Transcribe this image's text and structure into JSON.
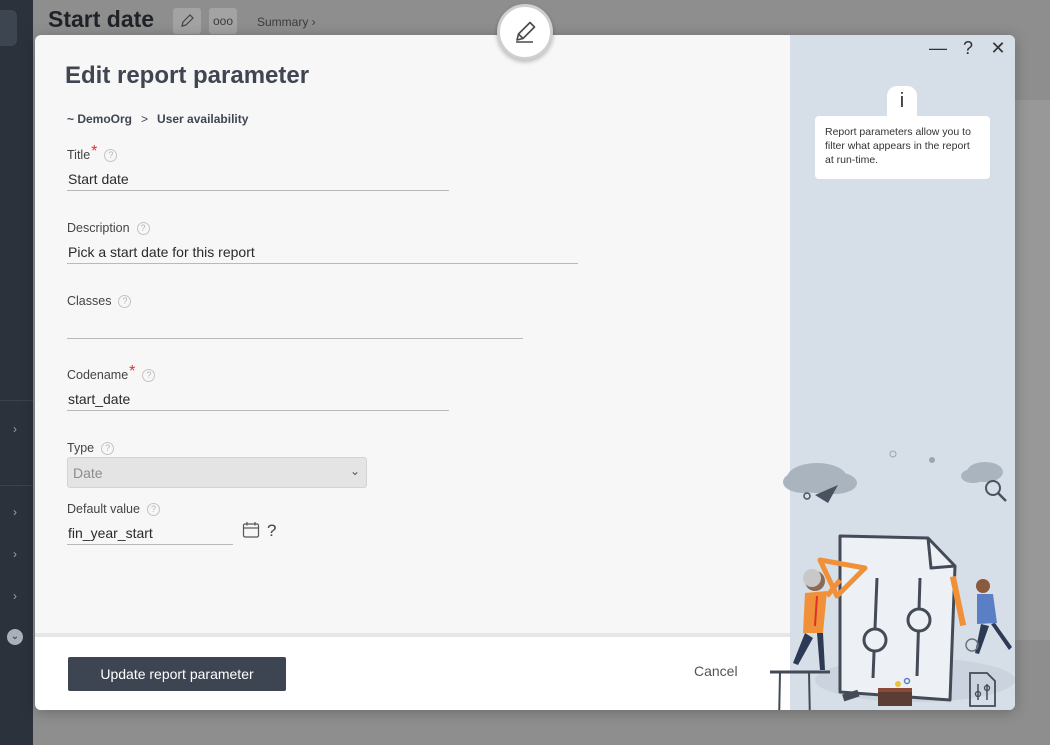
{
  "background": {
    "page_title": "Start date",
    "edit_icon": "pencil-icon",
    "more_icon": "ellipsis-icon",
    "more_label": "ooo",
    "breadcrumb": "Summary ›",
    "rail_chevron": "›",
    "rail_expand": "⌄"
  },
  "modal": {
    "badge_icon": "pencil-icon",
    "title": "Edit report parameter",
    "breadcrumb": {
      "org": "~ DemoOrg",
      "separator": ">",
      "page": "User availability"
    },
    "fields": {
      "title": {
        "label": "Title",
        "required_mark": "*",
        "value": "Start date"
      },
      "description": {
        "label": "Description",
        "value": "Pick a start date for this report"
      },
      "classes": {
        "label": "Classes",
        "value": ""
      },
      "codename": {
        "label": "Codename",
        "required_mark": "*",
        "value": "start_date"
      },
      "type": {
        "label": "Type",
        "selected": "Date",
        "chevron": "⌄"
      },
      "default_value": {
        "label": "Default value",
        "value": "fin_year_start",
        "help_mark": "?"
      }
    },
    "help_mark": "?",
    "primary_button": "Update report parameter",
    "cancel_button": "Cancel"
  },
  "side_panel": {
    "window_controls": {
      "minimize": "—",
      "help": "?",
      "close": "✕"
    },
    "info_icon_label": "i",
    "tip": "Report parameters allow you to filter what appears in the report at run-time."
  },
  "colors": {
    "primary": "#3d4553",
    "required": "#e0302b",
    "side_panel": "#d6dee8",
    "illustration_accent": "#f0913a"
  }
}
